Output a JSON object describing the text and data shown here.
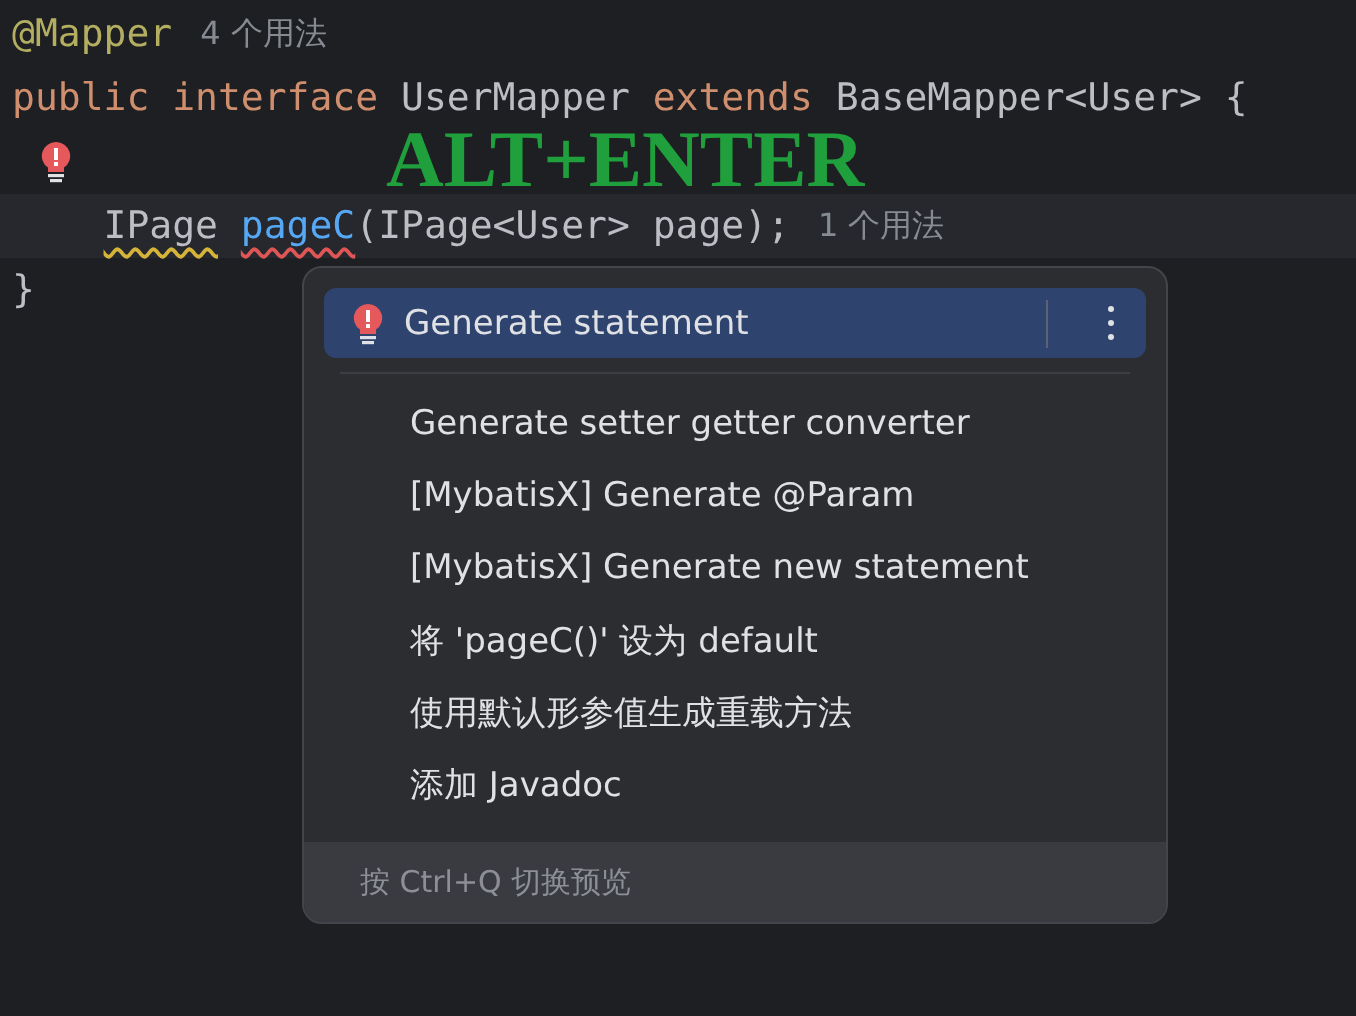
{
  "editor": {
    "lines": [
      {
        "current": false,
        "bulb": false,
        "tokens": [
          {
            "text": "@Mapper",
            "kind": "annotation"
          }
        ],
        "hint": "4 个用法"
      },
      {
        "current": false,
        "bulb": false,
        "tokens": [
          {
            "text": "public ",
            "kind": "keyword"
          },
          {
            "text": "interface ",
            "kind": "keyword"
          },
          {
            "text": "UserMapper ",
            "kind": "plain"
          },
          {
            "text": "extends ",
            "kind": "keyword"
          },
          {
            "text": "BaseMapper<User> {",
            "kind": "plain"
          }
        ]
      },
      {
        "current": false,
        "bulb": true
      },
      {
        "current": true,
        "bulb": false,
        "tokens": [
          {
            "text": "    IPage ",
            "kind": "plain",
            "warning": true,
            "error": false
          },
          {
            "text": "pageC",
            "kind": "method",
            "warning": false,
            "error": true
          },
          {
            "text": "(IPage<User> page);",
            "kind": "plain",
            "warning": false,
            "error": false
          }
        ],
        "hint": "1 个用法"
      },
      {
        "current": false,
        "bulb": false,
        "tokens": [
          {
            "text": "}",
            "kind": "plain"
          }
        ]
      }
    ]
  },
  "annotation": "ALT+ENTER",
  "popup": {
    "items": [
      {
        "label": "Generate statement",
        "kind": "primary",
        "selected": true
      },
      {
        "label": "Generate setter getter converter",
        "kind": "plain",
        "selected": false
      },
      {
        "label": "[MybatisX] Generate @Param",
        "kind": "plain",
        "selected": false
      },
      {
        "label": "[MybatisX] Generate new statement",
        "kind": "plain",
        "selected": false
      },
      {
        "label": "将 'pageC()' 设为 default",
        "kind": "plain",
        "selected": false
      },
      {
        "label": "使用默认形参值生成重载方法",
        "kind": "plain",
        "selected": false
      },
      {
        "label": "添加 Javadoc",
        "kind": "plain",
        "selected": false
      }
    ],
    "footer": "按 Ctrl+Q 切换预览"
  }
}
